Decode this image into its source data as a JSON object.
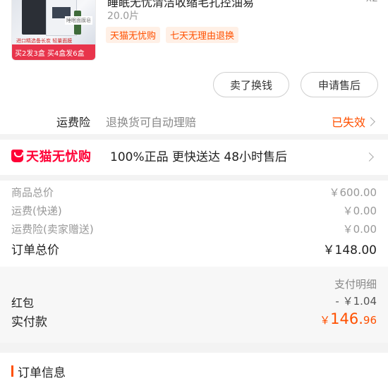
{
  "product": {
    "title": "睡眠无忧清洁收缩毛孔控油易",
    "quantity": "x2",
    "spec": "20.0片",
    "tags": [
      "天猫无忧购",
      "七天无理由退换"
    ],
    "thumb_banner": "买2发3盒 买4盒发6盒",
    "thumb_note": "进口精选备长炭 轻量面膜",
    "thumb_badge": "睡眠面膜皂"
  },
  "actions": {
    "sell_label": "卖了换钱",
    "after_sale_label": "申请售后"
  },
  "insurance": {
    "label": "运费险",
    "desc": "退换货可自动理赔",
    "status": "已失效"
  },
  "tmall_guarantee": {
    "brand": "天猫无忧购",
    "points": "100%正品  更快送达  48小时售后"
  },
  "fees": [
    {
      "label": "商品总价",
      "value": "￥600.00"
    },
    {
      "label": "运费(快递)",
      "value": "￥0.00"
    },
    {
      "label": "运费险(卖家赠送)",
      "value": "￥0.00"
    }
  ],
  "order_total": {
    "label": "订单总价",
    "value": "￥148.00"
  },
  "payment": {
    "detail_link": "支付明细",
    "red_packet_label": "红包",
    "red_packet_value": "- ￥1.04",
    "paid_label": "实付款",
    "paid_currency": "￥",
    "paid_int": "146.",
    "paid_dec": "96"
  },
  "order_info": {
    "title": "订单信息"
  },
  "colors": {
    "accent": "#ff5000",
    "tmall": "#ff0036",
    "divider": "#f3f3f3"
  }
}
